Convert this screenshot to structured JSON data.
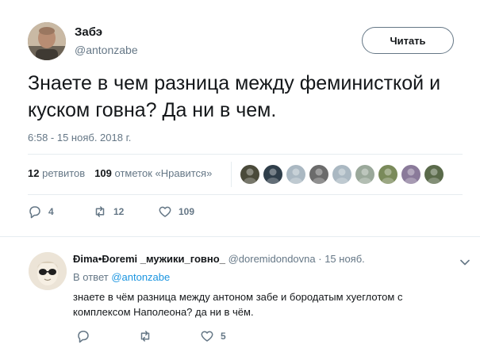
{
  "tweet": {
    "author_name": "Забэ",
    "author_handle": "@antonzabe",
    "follow_label": "Читать",
    "text": "Знаете в чем разница между феминисткой и куском говна? Да ни в чем.",
    "time": "6:58 - 15 нояб. 2018 г.",
    "stats": {
      "retweets_count": "12",
      "retweets_label": "ретвитов",
      "likes_count": "109",
      "likes_label": "отметок «Нравится»"
    },
    "liker_avatars": [
      {
        "color": "#4a4a3a"
      },
      {
        "color": "#2f3e4a"
      },
      {
        "color": "#aab8c2"
      },
      {
        "color": "#6b6b6b"
      },
      {
        "color": "#aab8c2"
      },
      {
        "color": "#9aa89a"
      },
      {
        "color": "#7a8a5a"
      },
      {
        "color": "#8a7a9a"
      },
      {
        "color": "#5a6a4a"
      }
    ],
    "actions": {
      "replies": "4",
      "retweets": "12",
      "likes": "109"
    }
  },
  "reply": {
    "author_name": "Ðima•Ðoremi _мужики_говно_",
    "author_handle": "@doremidondovna",
    "time": "· 15 нояб.",
    "reply_to_prefix": "В ответ",
    "reply_to_handle": "@antonzabe",
    "text": "знаете в чём разница между антоном забе и бородатым хуеглотом с комплексом Наполеона? да ни в чём.",
    "actions": {
      "replies": "",
      "retweets": "",
      "likes": "5"
    }
  },
  "colors": {
    "text_primary": "#14171a",
    "text_secondary": "#657786",
    "link": "#1b95e0",
    "divider": "#e6ecf0"
  }
}
